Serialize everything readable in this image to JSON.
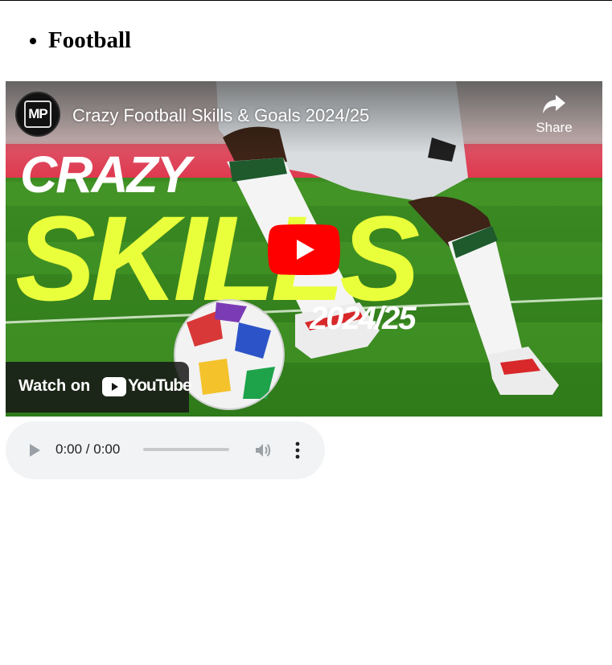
{
  "page": {
    "list_items": [
      {
        "label": "Football"
      }
    ]
  },
  "video": {
    "title": "Crazy Football Skills & Goals 2024/25",
    "channel_badge": "MP",
    "share_label": "Share",
    "watch_on_label": "Watch on",
    "platform_wordmark": "YouTube",
    "thumbnail_text": {
      "line1": "CRAZY",
      "line2": "SKILLS",
      "season": "2024/25"
    },
    "colors": {
      "play_red": "#ff0000",
      "skills_yellow": "#eaff3b",
      "pitch_green": "#3f8a26"
    }
  },
  "audio": {
    "time_display": "0:00 / 0:00",
    "progress": 0,
    "icons": [
      "play-icon",
      "volume-icon",
      "more-options-icon"
    ]
  }
}
